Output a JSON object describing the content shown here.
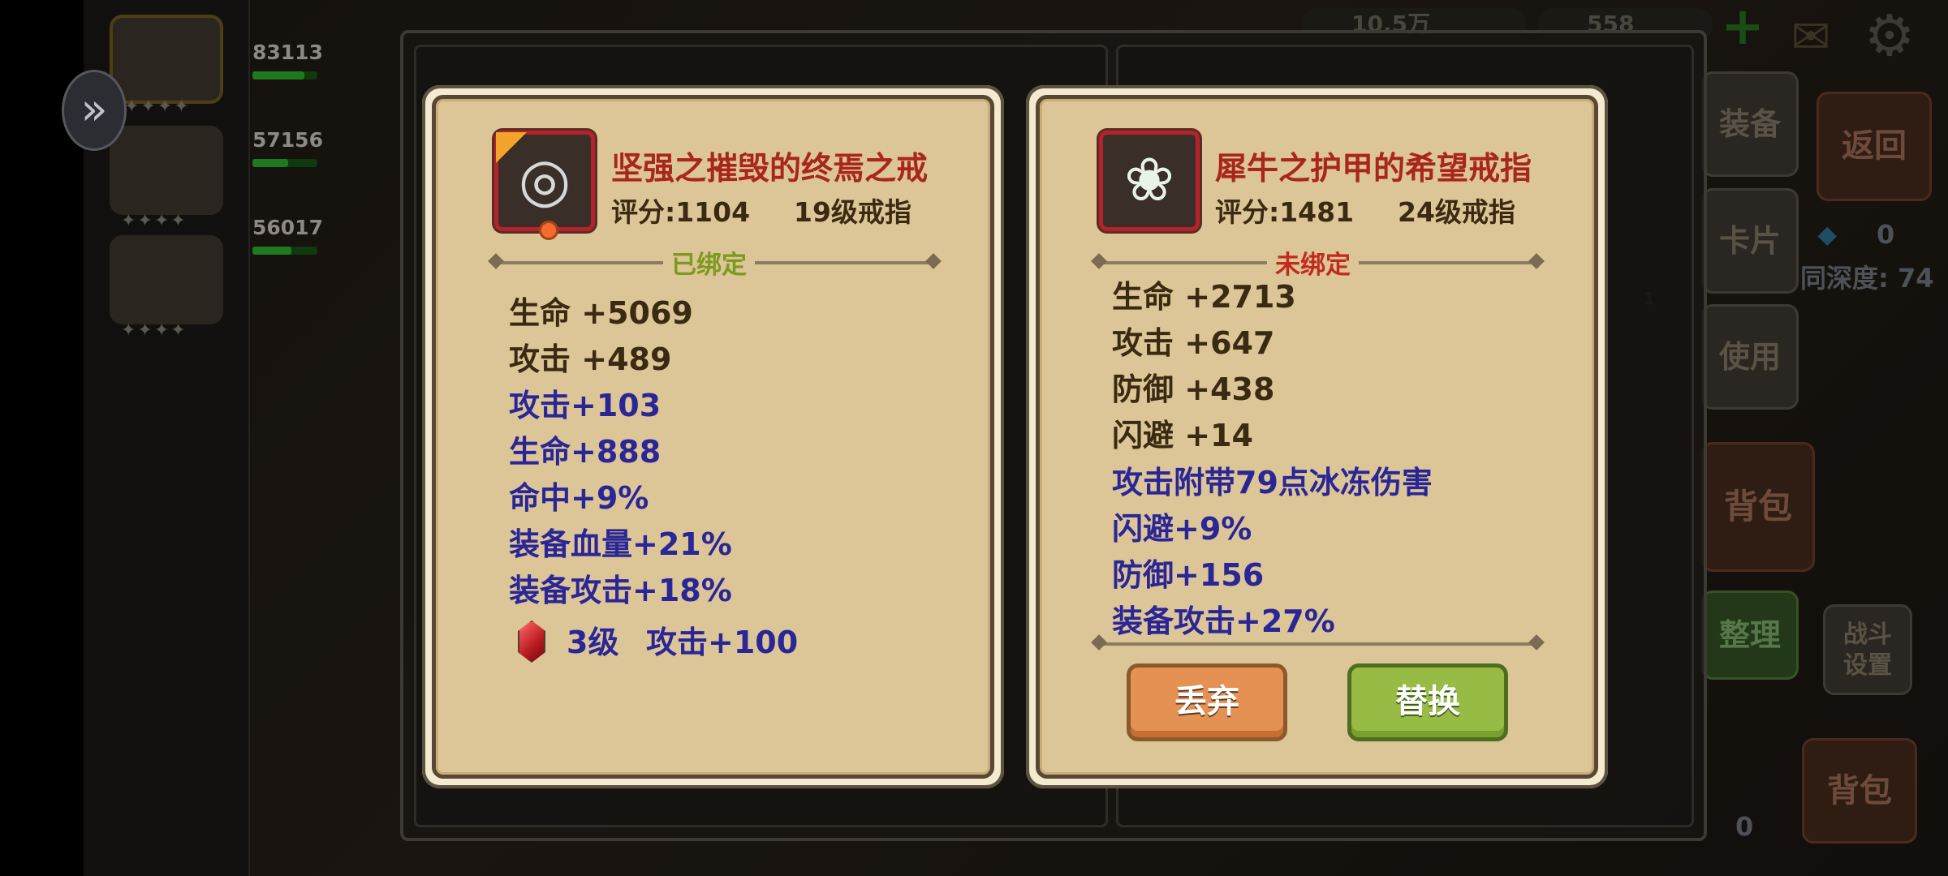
{
  "background": {
    "party": [
      {
        "hp": "83113",
        "hp_fill": 0.8
      },
      {
        "hp": "57156",
        "hp_fill": 0.55
      },
      {
        "hp": "56017",
        "hp_fill": 0.6
      }
    ],
    "hero_stars": "✦✦✦✦",
    "top_stats": [
      {
        "label": "10.5万"
      },
      {
        "label": "558"
      }
    ],
    "side_buttons": {
      "equip": "装备",
      "back": "返回",
      "card": "卡片",
      "use": "使用",
      "bag": "背包",
      "sort": "整理",
      "battle_settings_line1": "战斗",
      "battle_settings_line2": "设置",
      "bag2": "背包"
    },
    "gem_count": "0",
    "depth": "同深度: 74",
    "slot_count": "1",
    "bottom_count": "0"
  },
  "left_item": {
    "name": "坚强之摧毁的终焉之戒",
    "score": "评分:1104",
    "level": "19级戒指",
    "bind_status": "已绑定",
    "base_stats": [
      "生命 +5069",
      "攻击 +489"
    ],
    "extra_stats": [
      "攻击+103",
      "生命+888",
      "命中+9%",
      "装备血量+21%",
      "装备攻击+18%"
    ],
    "gem": {
      "level": "3级",
      "effect": "攻击+100"
    }
  },
  "right_item": {
    "name": "犀牛之护甲的希望戒指",
    "score": "评分:1481",
    "level": "24级戒指",
    "bind_status": "未绑定",
    "base_stats": [
      "生命 +2713",
      "攻击 +647",
      "防御 +438",
      "闪避 +14"
    ],
    "extra_stats": [
      "攻击附带79点冰冻伤害",
      "闪避+9%",
      "防御+156",
      "装备攻击+27%"
    ]
  },
  "buttons": {
    "discard": "丢弃",
    "replace": "替换"
  },
  "colors": {
    "item_name": "#a8271a",
    "bound": "#7c9a1e",
    "unbound": "#c22a20",
    "extra_stat": "#2a2696",
    "discard_button": "#e59154",
    "replace_button": "#97bb44"
  }
}
